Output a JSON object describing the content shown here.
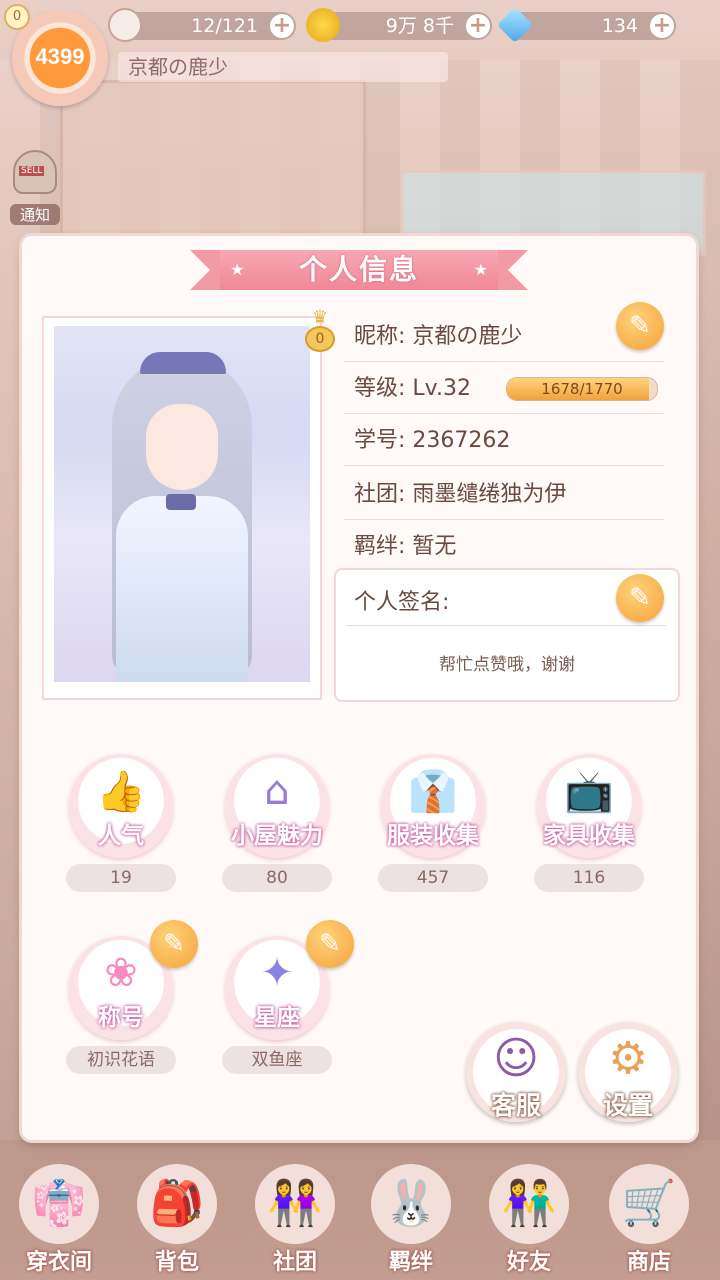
{
  "top_bar": {
    "avatar_badge": "4399",
    "avatar_level": "0",
    "energy": "12/121",
    "coins": "9万 8千",
    "diamonds": "134",
    "player_name": "京都の鹿少"
  },
  "notice": {
    "label": "通知"
  },
  "panel": {
    "title": "个人信息",
    "crown_value": "0",
    "info": [
      {
        "key": "昵称:",
        "value": "京都の鹿少"
      },
      {
        "key": "等级:",
        "value": "Lv.32"
      },
      {
        "key": "学号:",
        "value": "2367262"
      },
      {
        "key": "社团:",
        "value": "雨墨缱绻独为伊"
      },
      {
        "key": "羁绊:",
        "value": "暂无"
      }
    ],
    "xp": {
      "text": "1678/1770",
      "current": 1678,
      "max": 1770
    },
    "signature": {
      "label": "个人签名:",
      "text": "帮忙点赞哦，谢谢"
    },
    "stats": [
      {
        "label": "人气",
        "value": "19",
        "icon": "thumbs-up-icon"
      },
      {
        "label": "小屋魅力",
        "value": "80",
        "icon": "house-icon"
      },
      {
        "label": "服装收集",
        "value": "457",
        "icon": "clothes-icon"
      },
      {
        "label": "家具收集",
        "value": "116",
        "icon": "tv-icon"
      },
      {
        "label": "称号",
        "value": "初识花语",
        "icon": "wings-icon"
      },
      {
        "label": "星座",
        "value": "双鱼座",
        "icon": "constellation-icon"
      }
    ],
    "support_label": "客服",
    "settings_label": "设置"
  },
  "bottom_nav": [
    {
      "label": "穿衣间",
      "icon": "wardrobe-icon"
    },
    {
      "label": "背包",
      "icon": "backpack-icon"
    },
    {
      "label": "社团",
      "icon": "club-icon"
    },
    {
      "label": "羁绊",
      "icon": "bond-icon"
    },
    {
      "label": "好友",
      "icon": "friends-icon"
    },
    {
      "label": "商店",
      "icon": "shop-icon"
    }
  ],
  "colors": {
    "accent": "#f08897",
    "orange": "#f5a23a",
    "panel": "#fffaf8"
  }
}
